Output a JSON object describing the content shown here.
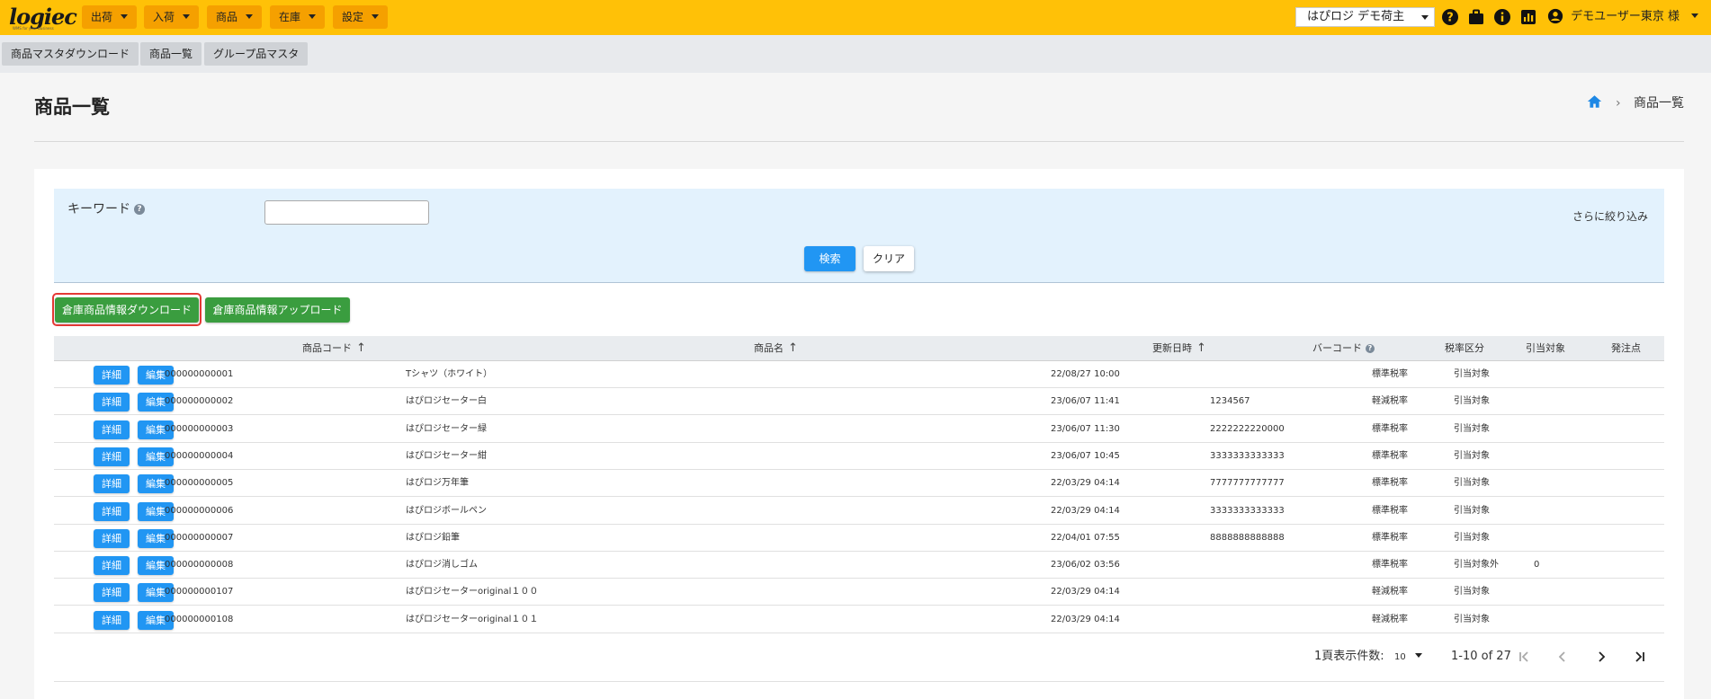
{
  "header": {
    "logo": "logiec",
    "logo_sub": "WMS for your business",
    "nav": [
      "出荷",
      "入荷",
      "商品",
      "在庫",
      "設定"
    ],
    "shipper": "はぴロジ デモ荷主",
    "user": "デモユーザー東京 様",
    "accent_color": "#ffc107"
  },
  "subnav": [
    "商品マスタダウンロード",
    "商品一覧",
    "グループ品マスタ"
  ],
  "page": {
    "title": "商品一覧",
    "breadcrumb": "商品一覧"
  },
  "search": {
    "keyword_label": "キーワード",
    "keyword_value": "",
    "keyword_placeholder": "",
    "refine": "さらに絞り込み",
    "search_btn": "検索",
    "clear_btn": "クリア"
  },
  "actions": {
    "download": "倉庫商品情報ダウンロード",
    "upload": "倉庫商品情報アップロード"
  },
  "table": {
    "headers": [
      "商品コード",
      "商品名",
      "更新日時",
      "バーコード",
      "税率区分",
      "引当対象",
      "発注点"
    ],
    "detail_btn": "詳細",
    "edit_btn": "編集",
    "rows": [
      [
        "000000000001",
        "Tシャツ（ホワイト）",
        "22/08/27 10:00",
        "",
        "標準税率",
        "引当対象",
        ""
      ],
      [
        "000000000002",
        "はぴロジセーター白",
        "23/06/07 11:41",
        "1234567",
        "軽減税率",
        "引当対象",
        ""
      ],
      [
        "000000000003",
        "はぴロジセーター緑",
        "23/06/07 11:30",
        "2222222220000",
        "標準税率",
        "引当対象",
        ""
      ],
      [
        "000000000004",
        "はぴロジセーター紺",
        "23/06/07 10:45",
        "3333333333333",
        "標準税率",
        "引当対象",
        ""
      ],
      [
        "000000000005",
        "はぴロジ万年筆",
        "22/03/29 04:14",
        "7777777777777",
        "標準税率",
        "引当対象",
        ""
      ],
      [
        "000000000006",
        "はぴロジボールペン",
        "22/03/29 04:14",
        "3333333333333",
        "標準税率",
        "引当対象",
        ""
      ],
      [
        "000000000007",
        "はぴロジ鉛筆",
        "22/04/01 07:55",
        "8888888888888",
        "標準税率",
        "引当対象",
        ""
      ],
      [
        "000000000008",
        "はぴロジ消しゴム",
        "23/06/02 03:56",
        "",
        "標準税率",
        "引当対象外",
        "0"
      ],
      [
        "000000000107",
        "はぴロジセーターoriginal１００",
        "22/03/29 04:14",
        "",
        "軽減税率",
        "引当対象",
        ""
      ],
      [
        "000000000108",
        "はぴロジセーターoriginal１０１",
        "22/03/29 04:14",
        "",
        "軽減税率",
        "引当対象",
        ""
      ]
    ]
  },
  "pagination": {
    "per_page_label": "1頁表示件数:",
    "per_page": "10",
    "range": "1-10 of 27"
  }
}
